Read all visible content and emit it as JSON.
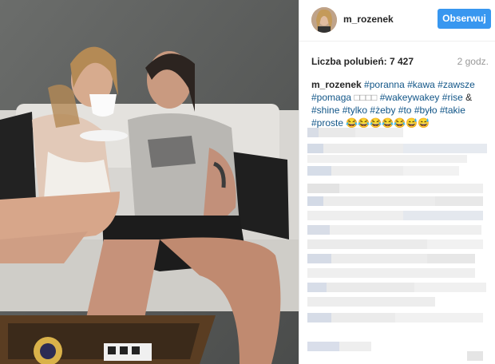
{
  "post": {
    "username": "m_rozenek",
    "follow_label": "Obserwuj",
    "likes_label": "Liczba polubień: 7 427",
    "time": "2 godz.",
    "caption": {
      "username": "m_rozenek",
      "line1_tags": [
        "#poranna",
        "#kawa",
        "#zawsze"
      ],
      "line2_tag1": "#pomaga",
      "line2_emoji": "□□□□",
      "line2_tags": [
        "#wakeywakey",
        "#rise"
      ],
      "line2_end": "&",
      "line3_tags": [
        "#shine",
        "#tylko",
        "#żeby",
        "#to",
        "#było",
        "#takie"
      ],
      "line4_tag": "#proste",
      "line4_emoji": "😂😂😂😂😂😅😅"
    }
  },
  "colors": {
    "follow_button": "#3897f0",
    "hashtag": "#125688",
    "muted": "#999999"
  },
  "icons": {
    "avatar": "profile-photo",
    "photo": "couple-on-sofa-drinking-coffee"
  }
}
